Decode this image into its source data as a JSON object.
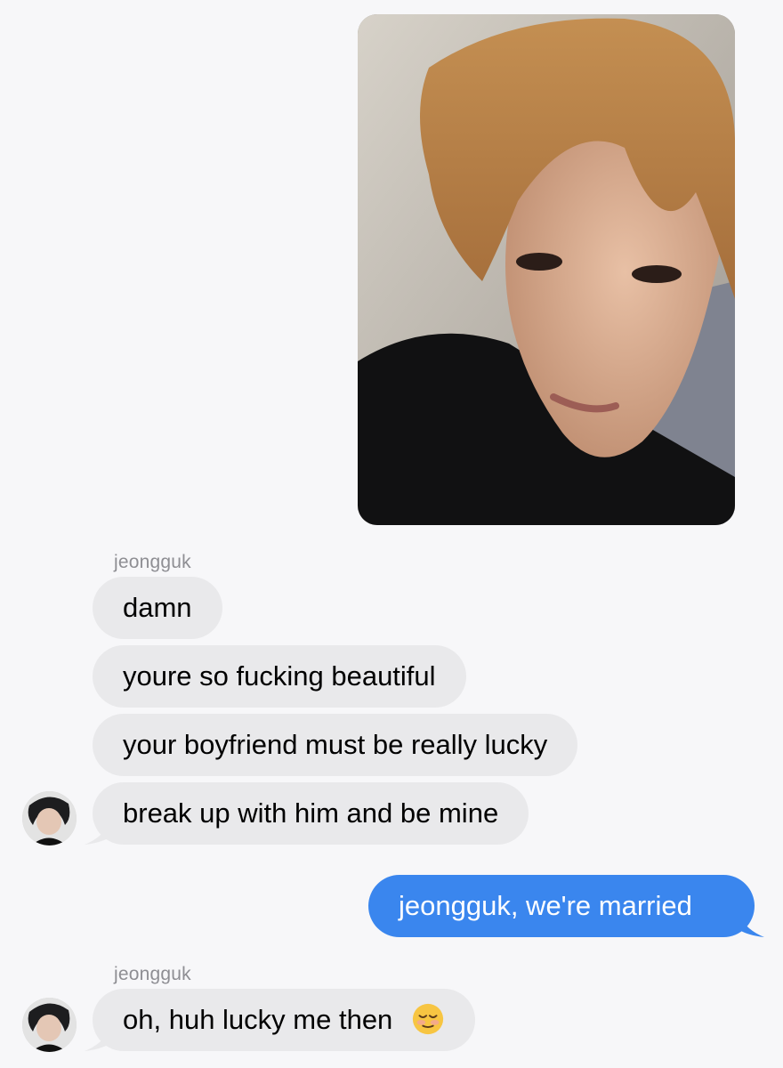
{
  "conversation": {
    "photo": {
      "description_icon": "photo-message-icon"
    },
    "group1": {
      "sender": "jeongguk",
      "messages": [
        "damn",
        "youre so fucking beautiful",
        "your boyfriend must be really lucky",
        "break up with him and be mine"
      ]
    },
    "outgoing": {
      "text": "jeongguk, we're married"
    },
    "group2": {
      "sender": "jeongguk",
      "message": "oh, huh lucky me then",
      "emoji": "smiling-face-icon"
    }
  },
  "colors": {
    "background": "#f7f7f9",
    "incoming_bubble": "#e9e9eb",
    "outgoing_bubble": "#3a86ee",
    "sender_name": "#8e8e93"
  }
}
